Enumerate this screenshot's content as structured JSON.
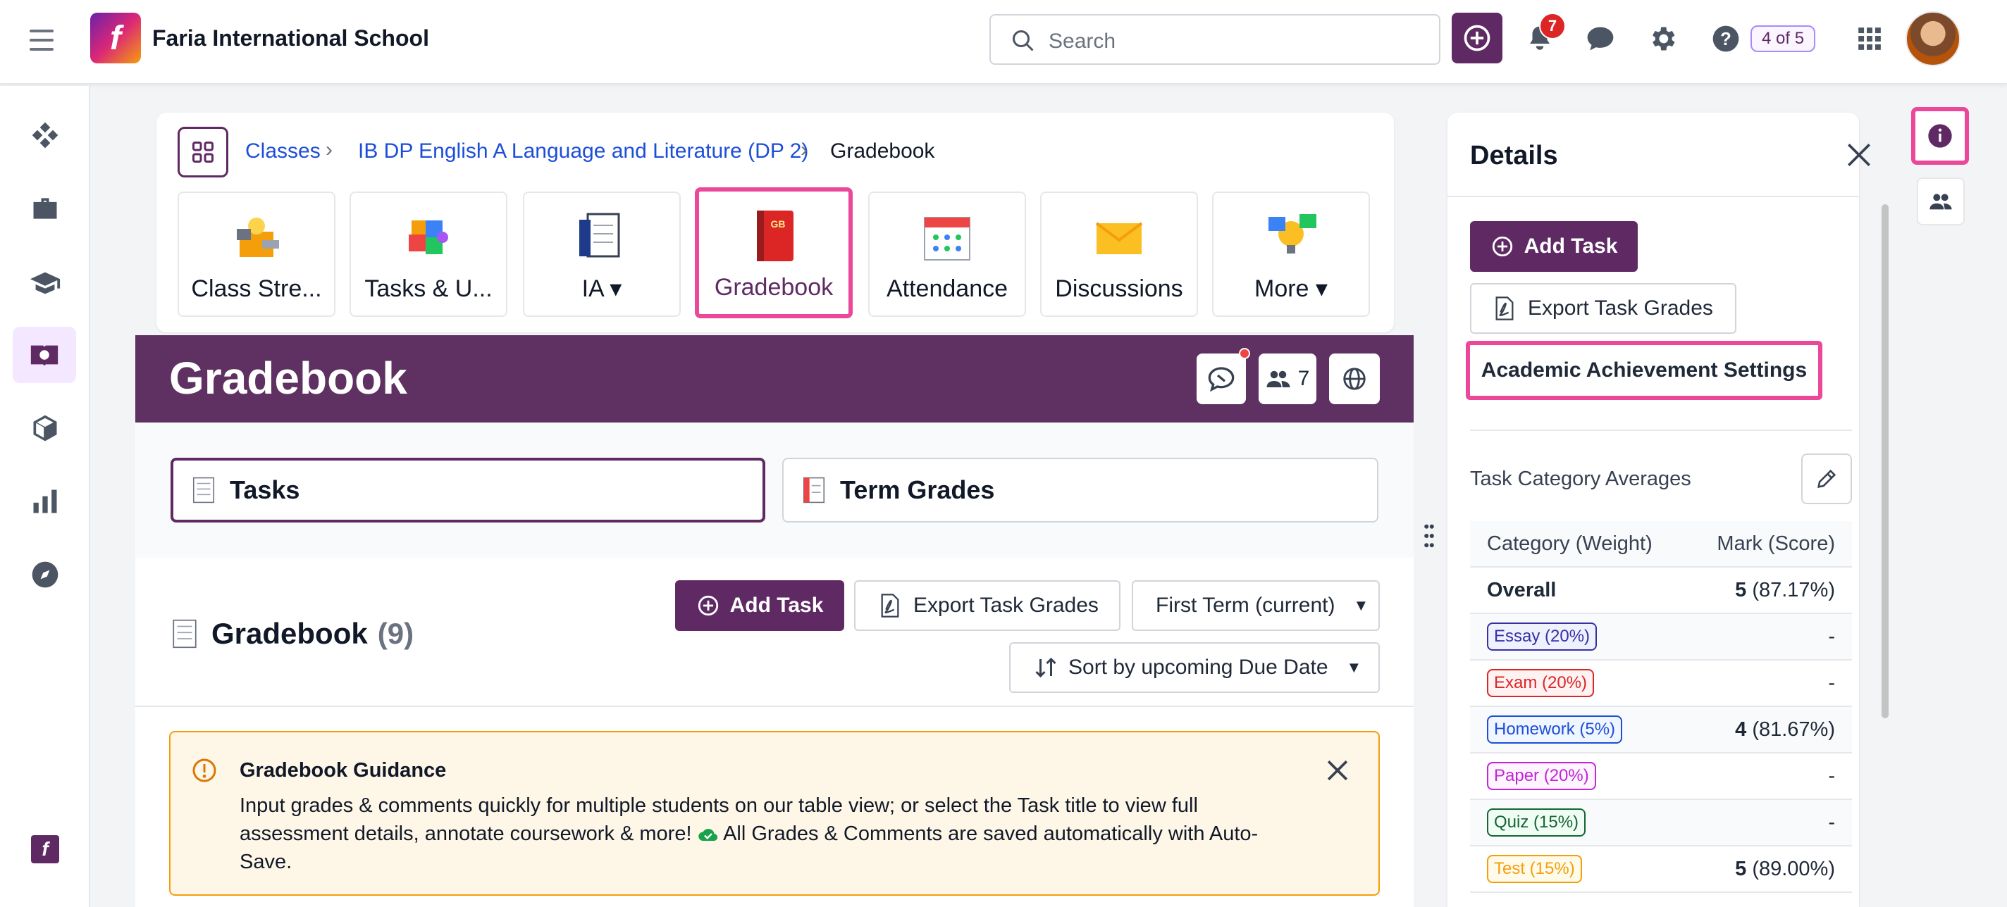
{
  "topbar": {
    "school_name": "Faria International School",
    "logo_letter": "f",
    "search_placeholder": "Search",
    "notifications_count": "7",
    "page_indicator": "4 of 5"
  },
  "breadcrumb": {
    "items": [
      "Classes",
      "IB DP English A Language and Literature (DP 2)",
      "Gradebook"
    ]
  },
  "class_tiles": [
    {
      "label": "Class Stre..."
    },
    {
      "label": "Tasks & U..."
    },
    {
      "label": "IA ▾"
    },
    {
      "label": "Gradebook",
      "active": true
    },
    {
      "label": "Attendance"
    },
    {
      "label": "Discussions"
    },
    {
      "label": "More ▾"
    }
  ],
  "header": {
    "title": "Gradebook",
    "members_count": "7"
  },
  "tabs": {
    "tasks": "Tasks",
    "term_grades": "Term Grades"
  },
  "gradebook": {
    "heading": "Gradebook",
    "count": "(9)",
    "add_task": "Add Task",
    "export": "Export Task Grades",
    "term_select": "First Term (current)",
    "sort": "Sort by upcoming Due Date"
  },
  "guidance": {
    "title": "Gradebook Guidance",
    "text_1": "Input grades & comments quickly for multiple students on our table view; or select the Task title to view full assessment details, annotate coursework & more!",
    "text_2": "All Grades & Comments are saved automatically with Auto-Save."
  },
  "details": {
    "title": "Details",
    "add_task": "Add Task",
    "export": "Export Task Grades",
    "settings": "Academic Achievement Settings",
    "averages_title": "Task Category Averages",
    "col_category": "Category (Weight)",
    "col_mark": "Mark (Score)",
    "overall_label": "Overall",
    "overall_mark": "5",
    "overall_score": "(87.17%)",
    "rows": [
      {
        "label": "Essay (20%)",
        "mark": "",
        "score": "-",
        "color": "#3730a3",
        "bg": "#eef2ff"
      },
      {
        "label": "Exam (20%)",
        "mark": "",
        "score": "-",
        "color": "#dc2626",
        "bg": "#fef2f2"
      },
      {
        "label": "Homework (5%)",
        "mark": "4",
        "score": "(81.67%)",
        "color": "#1d4ed8",
        "bg": "#eff6ff"
      },
      {
        "label": "Paper (20%)",
        "mark": "",
        "score": "-",
        "color": "#c026d3",
        "bg": "#fdf4ff"
      },
      {
        "label": "Quiz (15%)",
        "mark": "",
        "score": "-",
        "color": "#166534",
        "bg": "#f0fdf4"
      },
      {
        "label": "Test (15%)",
        "mark": "5",
        "score": "(89.00%)",
        "color": "#f59e0b",
        "bg": "#fffbeb"
      }
    ]
  },
  "colors": {
    "brand": "#5f2a64",
    "highlight": "#ec4899"
  }
}
